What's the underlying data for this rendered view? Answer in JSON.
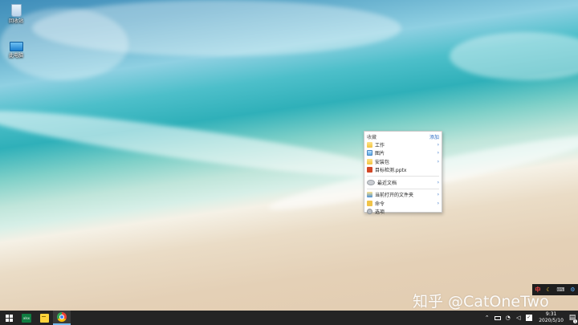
{
  "desktop": {
    "icons": [
      {
        "label": "回收站",
        "icon": "recycle-bin-icon"
      },
      {
        "label": "此电脑",
        "icon": "this-pc-icon"
      }
    ]
  },
  "menu": {
    "header": "收藏",
    "header_action": "添加",
    "groups": [
      [
        {
          "label": "工作",
          "icon": "folder-icon",
          "submenu": true
        },
        {
          "label": "图片",
          "icon": "picture-icon",
          "submenu": true
        },
        {
          "label": "安装包",
          "icon": "folder-icon",
          "submenu": true
        },
        {
          "label": "目标检测.pptx",
          "icon": "pptx-icon",
          "submenu": false
        }
      ],
      [
        {
          "label": "最近文档",
          "icon": "clock-icon",
          "submenu": true
        }
      ],
      [
        {
          "label": "当前打开的文件夹",
          "icon": "explorer-icon",
          "submenu": true
        },
        {
          "label": "命令",
          "icon": "command-icon",
          "submenu": true
        },
        {
          "label": "选项",
          "icon": "gear-icon",
          "submenu": false
        }
      ]
    ],
    "arrow_glyph": "›"
  },
  "tray_popup": {
    "ime": "中",
    "moon": "☾",
    "keyboard": "⌨",
    "settings": "⚙"
  },
  "watermark": "知乎 @CatOneTwo",
  "taskbar": {
    "xlsx_label": "xlsx",
    "clock_time": "9:31",
    "clock_date": "2020/5/10",
    "tray_caret": "⌃",
    "check_glyph": "✓",
    "notify_glyph": "▤",
    "notify_count": "1"
  },
  "colors": {
    "accent": "#2b6cc4",
    "taskbar": "#242424",
    "active_indicator": "#76b9ed"
  }
}
